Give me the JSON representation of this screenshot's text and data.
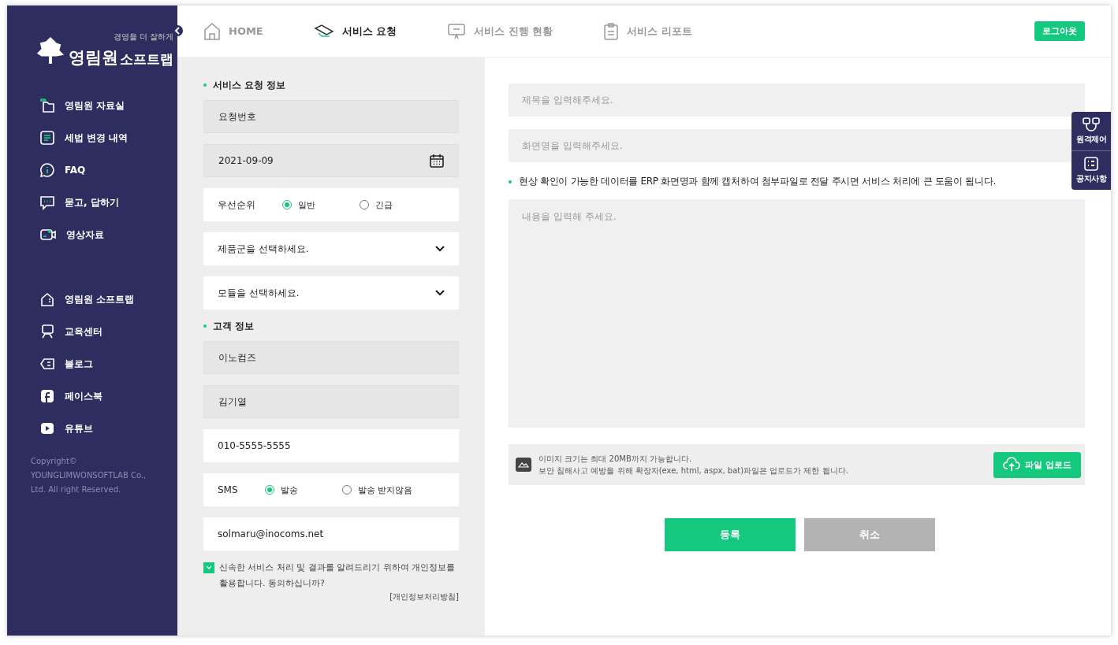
{
  "logo": {
    "name_top": "영림원",
    "name_bottom": "소프트랩",
    "slogan": "경영을 더 잘하게"
  },
  "nav": [
    {
      "label": "HOME",
      "selected": false
    },
    {
      "label": "서비스 요청",
      "selected": true
    },
    {
      "label": "서비스 진행 현황",
      "selected": false
    },
    {
      "label": "서비스 리포트",
      "selected": false
    }
  ],
  "logout": "로그아웃",
  "sidebar": {
    "groups": [
      [
        {
          "label": "영림원 자료실"
        },
        {
          "label": "세법 변경 내역"
        },
        {
          "label": "FAQ"
        },
        {
          "label": "묻고, 답하기"
        },
        {
          "label": "영상자료"
        }
      ],
      [
        {
          "label": "영림원 소프트랩"
        },
        {
          "label": "교육센터"
        },
        {
          "label": "블로그"
        },
        {
          "label": "페이스북"
        },
        {
          "label": "유튜브"
        }
      ]
    ],
    "copyright": [
      "Copyright©",
      "YOUNGLIMWONSOFTLAB Co.,",
      "Ltd. All right Reserved."
    ]
  },
  "form": {
    "sections": [
      {
        "title": "서비스 요청 정보",
        "fields": [
          {
            "kind": "text",
            "readonly": true,
            "value": "요청번호"
          },
          {
            "kind": "date",
            "readonly": true,
            "value": "2021-09-09"
          },
          {
            "kind": "radio",
            "label": "우선순위",
            "options": [
              {
                "label": "일반",
                "selected": true
              },
              {
                "label": "긴급",
                "selected": false
              }
            ]
          },
          {
            "kind": "select",
            "placeholder": "제품군을 선택하세요."
          },
          {
            "kind": "select",
            "placeholder": "모듈을 선택하세요."
          }
        ]
      },
      {
        "title": "고객 정보",
        "fields": [
          {
            "kind": "text",
            "readonly": true,
            "value": "이노컴즈"
          },
          {
            "kind": "text",
            "readonly": true,
            "value": "김기열"
          },
          {
            "kind": "text",
            "readonly": false,
            "value": "010-5555-5555"
          },
          {
            "kind": "radio",
            "label": "SMS",
            "options": [
              {
                "label": "발송",
                "selected": true
              },
              {
                "label": "발송 받지않음",
                "selected": false
              }
            ]
          },
          {
            "kind": "text",
            "readonly": false,
            "value": "solmaru@inocoms.net"
          }
        ]
      }
    ],
    "consent": {
      "checked": true,
      "text": "신속한 서비스 처리 및 결과를 알려드리기 위하여 개인정보를 활용합니다. 동의하십니까?",
      "link": "[개인정보처리방침]"
    }
  },
  "request": {
    "title_placeholder": "제목을 입력해주세요.",
    "screen_placeholder": "화면명을 입력해주세요.",
    "notice": "현상 확인이 가능한 데이터를 ERP 화면명과 함께 캡처하여 첨부파일로 전달 주시면 서비스 처리에 큰 도움이 됩니다.",
    "content_placeholder": "내용을 입력해 주세요.",
    "upload_info": [
      "이미지 크기는 최대 20MB까지 가능합니다.",
      "보안 침해사고 예방을 위해 확장자(exe, html, aspx, bat)파일은 업로드가 제한 됩니다."
    ],
    "upload_button": "파일 업로드",
    "submit": "등록",
    "cancel": "취소"
  },
  "quick_menu": [
    {
      "label": "원격제어"
    },
    {
      "label": "공지사항"
    }
  ]
}
